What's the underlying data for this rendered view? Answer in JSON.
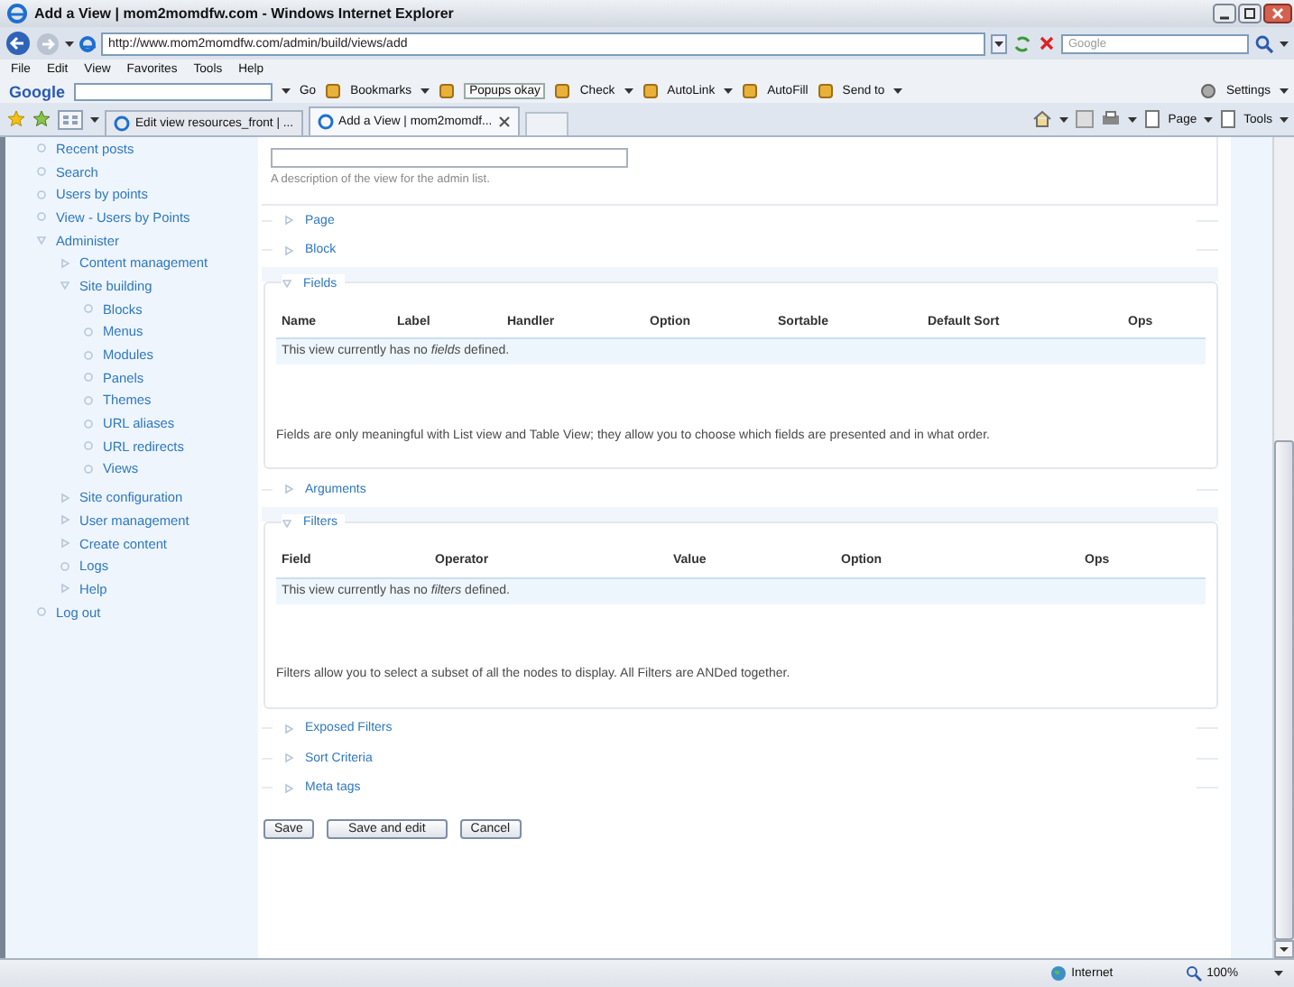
{
  "window": {
    "title": "Add a View | mom2momdfw.com - Windows Internet Explorer"
  },
  "address_bar": {
    "url": "http://www.mom2momdfw.com/admin/build/views/add",
    "search_placeholder": "Google"
  },
  "menu_bar": [
    "File",
    "Edit",
    "View",
    "Favorites",
    "Tools",
    "Help"
  ],
  "google_toolbar": {
    "logo": "Google",
    "items": [
      {
        "label": "Go",
        "kind": "text",
        "dropdown": false
      },
      {
        "label": "Bookmarks",
        "kind": "button",
        "dropdown": true
      },
      {
        "label": "Popups okay",
        "kind": "toggle",
        "dropdown": false
      },
      {
        "label": "Check",
        "kind": "button",
        "dropdown": true
      },
      {
        "label": "AutoLink",
        "kind": "button",
        "dropdown": true
      },
      {
        "label": "AutoFill",
        "kind": "button",
        "dropdown": false
      },
      {
        "label": "Send to",
        "kind": "button",
        "dropdown": true
      }
    ],
    "settings": "Settings"
  },
  "tabs": [
    {
      "label": "Edit view resources_front | ...",
      "selected": false
    },
    {
      "label": "Add a View | mom2momdf...",
      "selected": true
    }
  ],
  "command_bar": [
    "Page",
    "Tools"
  ],
  "sidebar": {
    "items": [
      {
        "label": "Recent posts",
        "kind": "leaf"
      },
      {
        "label": "Search",
        "kind": "leaf"
      },
      {
        "label": "Users by points",
        "kind": "leaf"
      },
      {
        "label": "View - Users by Points",
        "kind": "leaf"
      },
      {
        "label": "Administer",
        "kind": "expanded",
        "children": [
          {
            "label": "Content management",
            "kind": "collapsed"
          },
          {
            "label": "Site building",
            "kind": "expanded",
            "children": [
              {
                "label": "Blocks",
                "kind": "leaf"
              },
              {
                "label": "Menus",
                "kind": "leaf"
              },
              {
                "label": "Modules",
                "kind": "leaf"
              },
              {
                "label": "Panels",
                "kind": "leaf"
              },
              {
                "label": "Themes",
                "kind": "leaf"
              },
              {
                "label": "URL aliases",
                "kind": "leaf"
              },
              {
                "label": "URL redirects",
                "kind": "leaf"
              },
              {
                "label": "Views",
                "kind": "leaf"
              }
            ]
          },
          {
            "label": "Site configuration",
            "kind": "collapsed"
          },
          {
            "label": "User management",
            "kind": "collapsed"
          },
          {
            "label": "Create content",
            "kind": "collapsed"
          },
          {
            "label": "Logs",
            "kind": "leaf"
          },
          {
            "label": "Help",
            "kind": "collapsed"
          }
        ]
      },
      {
        "label": "Log out",
        "kind": "leaf"
      }
    ]
  },
  "form": {
    "description_hint": "A description of the view for the admin list.",
    "sections": [
      {
        "title": "Page",
        "expanded": false
      },
      {
        "title": "Block",
        "expanded": false
      },
      {
        "title": "Fields",
        "expanded": true,
        "columns": [
          "Name",
          "Label",
          "Handler",
          "Option",
          "Sortable",
          "Default Sort",
          "Ops"
        ],
        "empty_text": "This view currently has no *fields* defined.",
        "help": "Fields are only meaningful with List view and Table View; they allow you to choose which fields are presented and in what order."
      },
      {
        "title": "Arguments",
        "expanded": false
      },
      {
        "title": "Filters",
        "expanded": true,
        "columns": [
          "Field",
          "Operator",
          "Value",
          "Option",
          "Ops"
        ],
        "empty_text": "This view currently has no *filters* defined.",
        "help": "Filters allow you to select a subset of all the nodes to display. All Filters are ANDed together."
      },
      {
        "title": "Exposed Filters",
        "expanded": false
      },
      {
        "title": "Sort Criteria",
        "expanded": false
      },
      {
        "title": "Meta tags",
        "expanded": false
      }
    ],
    "buttons": [
      "Save",
      "Save and edit",
      "Cancel"
    ]
  },
  "status_bar": {
    "zone": "Internet",
    "zoom": "100%"
  }
}
